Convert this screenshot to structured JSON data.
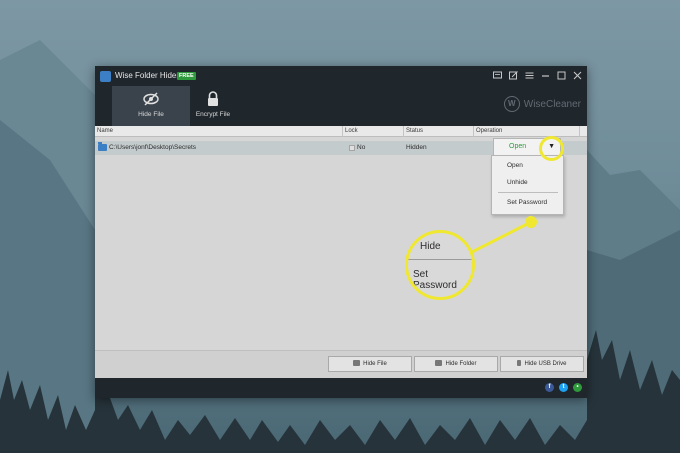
{
  "app": {
    "title": "Wise Folder Hider",
    "badge": "FREE",
    "brand": "WiseCleaner",
    "brand_logo_letter": "W"
  },
  "window_controls": [
    "feedback-icon",
    "edit-icon",
    "menu-icon",
    "minimize-icon",
    "maximize-icon",
    "close-icon"
  ],
  "tabs": [
    {
      "label": "Hide File",
      "icon": "eye-slash-icon",
      "active": true
    },
    {
      "label": "Encrypt File",
      "icon": "padlock-icon",
      "active": false
    }
  ],
  "table": {
    "columns": [
      "Name",
      "Lock",
      "Status",
      "Operation"
    ],
    "rows": [
      {
        "name": "C:\\Users\\jonf\\Desktop\\Secrets",
        "lock": "No",
        "status": "Hidden",
        "operation": "Open"
      }
    ]
  },
  "dropdown": {
    "items": [
      "Open",
      "Unhide",
      "Set Password"
    ]
  },
  "callout": {
    "top_text": "Hide",
    "main_text": "Set Password"
  },
  "buttons": {
    "hide_file": "Hide File",
    "hide_folder": "Hide Folder",
    "hide_usb": "Hide USB Drive"
  },
  "social": [
    "facebook-icon",
    "twitter-icon",
    "message-icon"
  ],
  "colors": {
    "titlebar": "#1f262c",
    "highlight": "#f0e830",
    "open_green": "#2f9a3c",
    "folder_blue": "#3d7fc4"
  }
}
